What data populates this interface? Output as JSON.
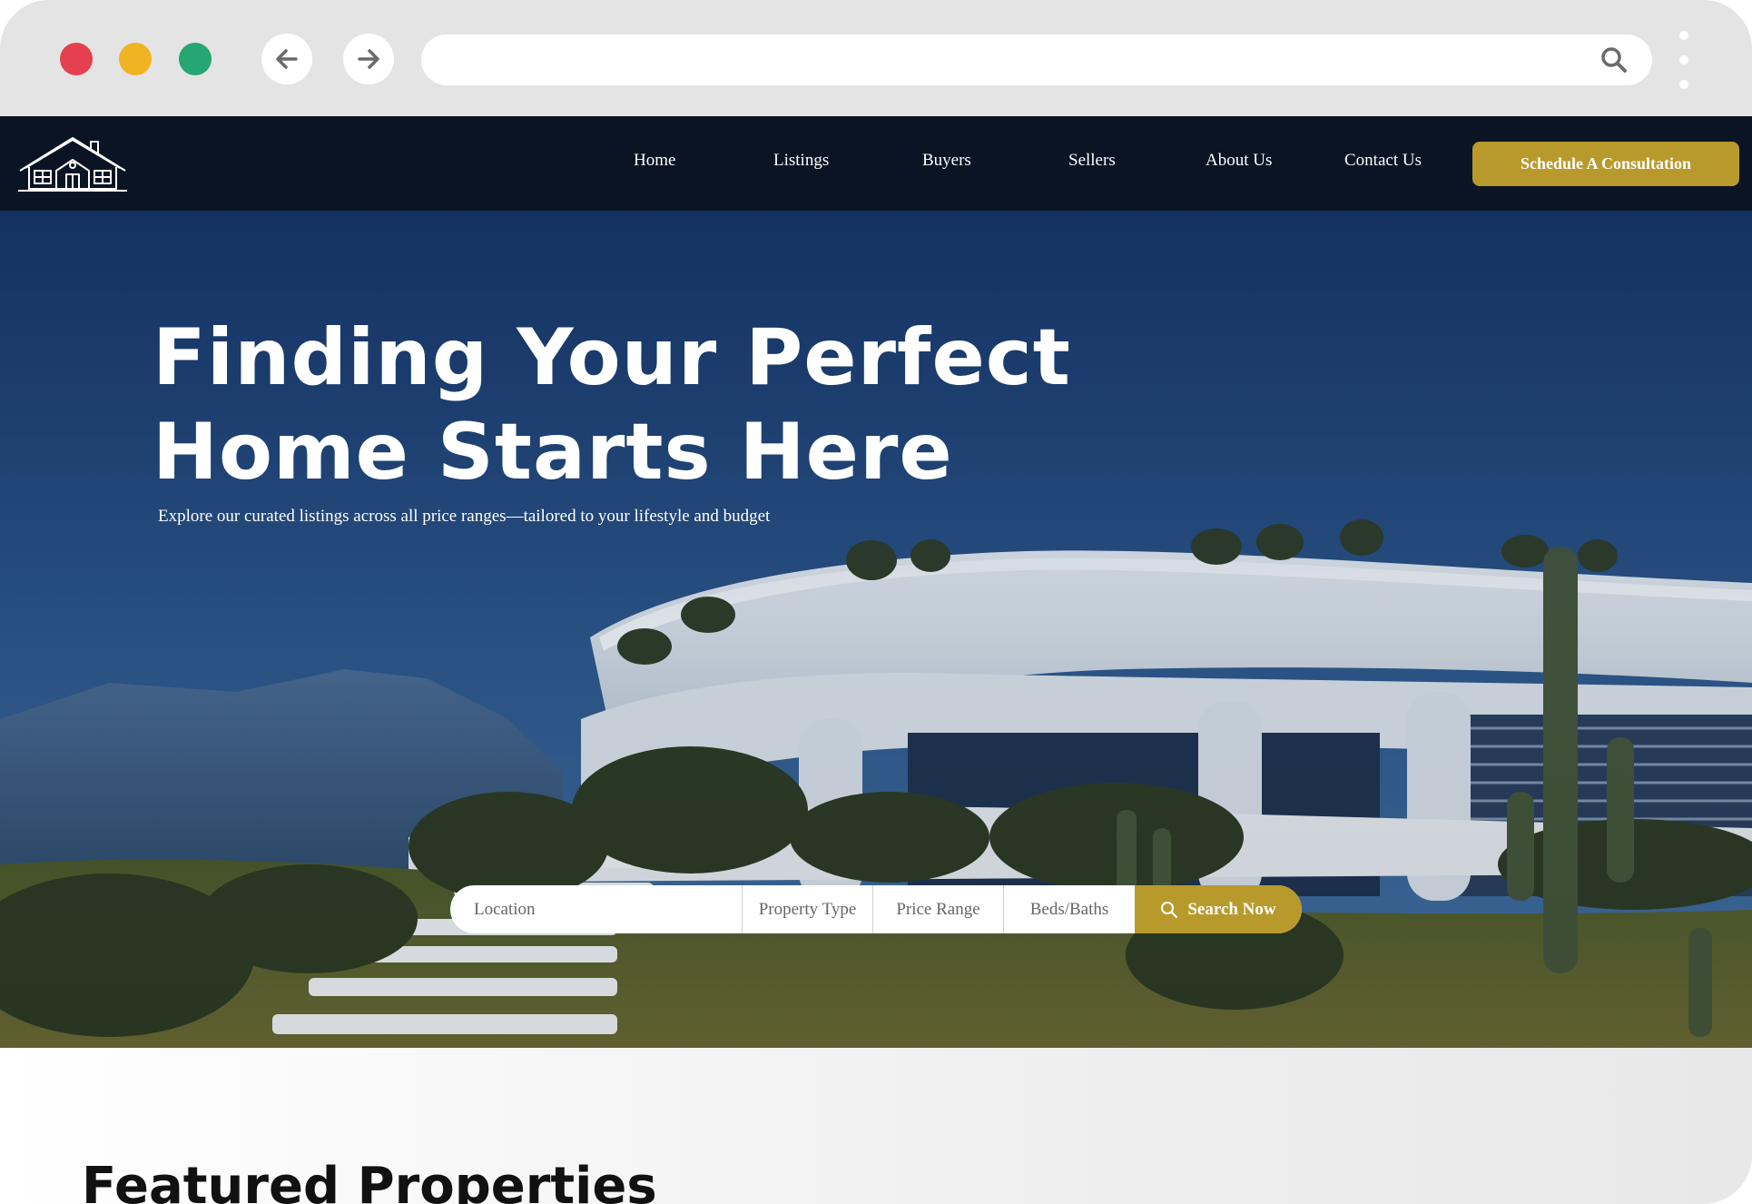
{
  "site": {
    "nav": {
      "items": [
        {
          "label": "Home"
        },
        {
          "label": "Listings"
        },
        {
          "label": "Buyers"
        },
        {
          "label": "Sellers"
        },
        {
          "label": "About Us"
        },
        {
          "label": "Contact Us"
        }
      ],
      "cta_label": "Schedule A Consultation"
    },
    "hero": {
      "title_line1": "Finding Your Perfect",
      "title_line2": "Home Starts Here",
      "subtitle": "Explore our curated listings across all price ranges—tailored to your lifestyle and budget"
    },
    "search": {
      "location_placeholder": "Location",
      "property_type_label": "Property Type",
      "price_range_label": "Price Range",
      "beds_baths_label": "Beds/Baths",
      "button_label": "Search Now"
    },
    "featured": {
      "title": "Featured Properties"
    }
  },
  "icons": {
    "logo": "house-logo-icon",
    "back": "arrow-left-icon",
    "forward": "arrow-right-icon",
    "url_search": "search-icon",
    "menu": "kebab-menu-icon",
    "search_button": "search-icon"
  },
  "colors": {
    "accent": "#b89a2c",
    "header_bg": "#0a1424",
    "traffic_red": "#e5404f",
    "traffic_yellow": "#f0b324",
    "traffic_green": "#25a672"
  }
}
